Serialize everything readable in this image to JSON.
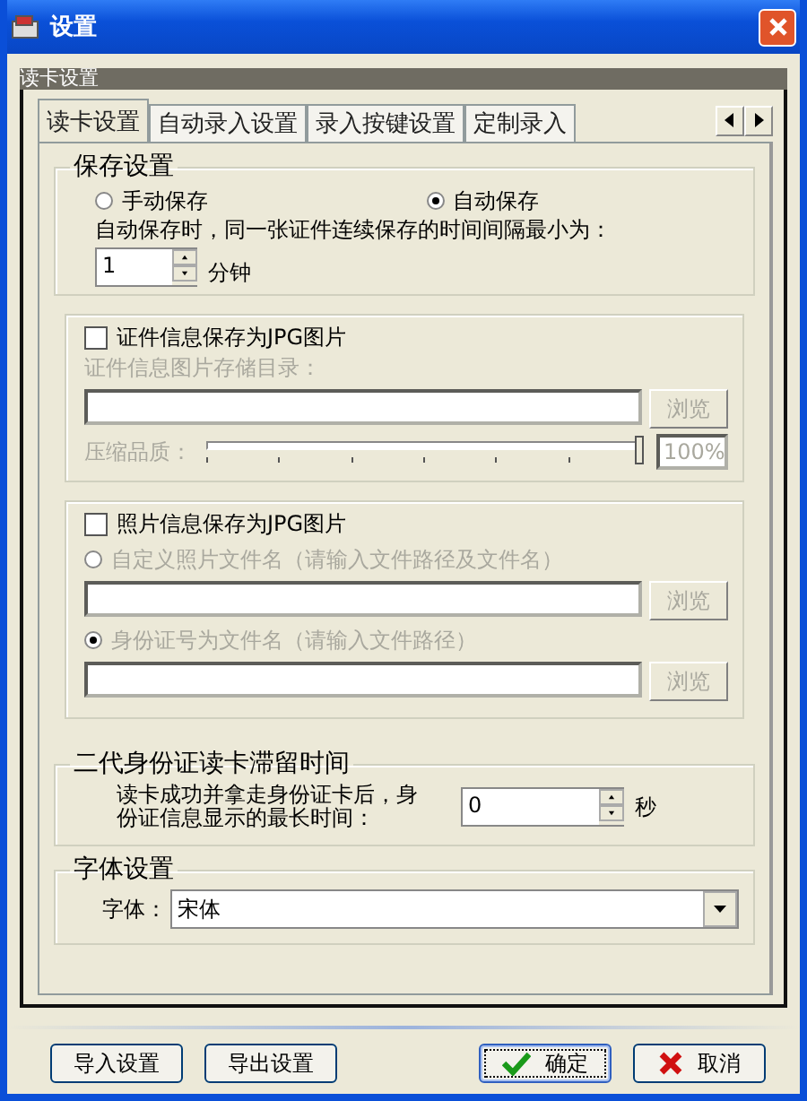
{
  "window": {
    "title": "设置"
  },
  "panel_title": "读卡设置",
  "tabs": [
    {
      "label": "读卡设置",
      "selected": true
    },
    {
      "label": "自动录入设置",
      "selected": false
    },
    {
      "label": "录入按键设置",
      "selected": false
    },
    {
      "label": "定制录入",
      "selected": false
    }
  ],
  "save_settings": {
    "title": "保存设置",
    "options": [
      {
        "label": "手动保存",
        "selected": false
      },
      {
        "label": "自动保存",
        "selected": true
      }
    ],
    "interval_label": "自动保存时，同一张证件连续保存的时间间隔最小为：",
    "interval_value": "1",
    "interval_unit": "分钟"
  },
  "id_image": {
    "label": "证件信息保存为JPG图片",
    "checked": false,
    "dir_label": "证件信息图片存储目录：",
    "browse": "浏览",
    "quality_label": "压缩品质：",
    "quality": {
      "level": 1
    },
    "quality_value": "100%"
  },
  "photo_image": {
    "label": "照片信息保存为JPG图片",
    "checked": false,
    "options": [
      {
        "label": "自定义照片文件名（请输入文件路径及文件名）",
        "selected": false,
        "browse": "浏览"
      },
      {
        "label": "身份证号为文件名（请输入文件路径）",
        "selected": true,
        "browse": "浏览"
      }
    ]
  },
  "dwell": {
    "title": "二代身份证读卡滞留时间",
    "label": "读卡成功并拿走身份证卡后，身份证信息显示的最长时间：",
    "value": "0",
    "unit": "秒"
  },
  "font": {
    "title": "字体设置",
    "label": "字体：",
    "value": "宋体"
  },
  "buttons": [
    {
      "label": "导入设置",
      "kind": "plain"
    },
    {
      "label": "导出设置",
      "kind": "plain"
    },
    {
      "label": "确定",
      "kind": "ok"
    },
    {
      "label": "取消",
      "kind": "cancel"
    }
  ]
}
